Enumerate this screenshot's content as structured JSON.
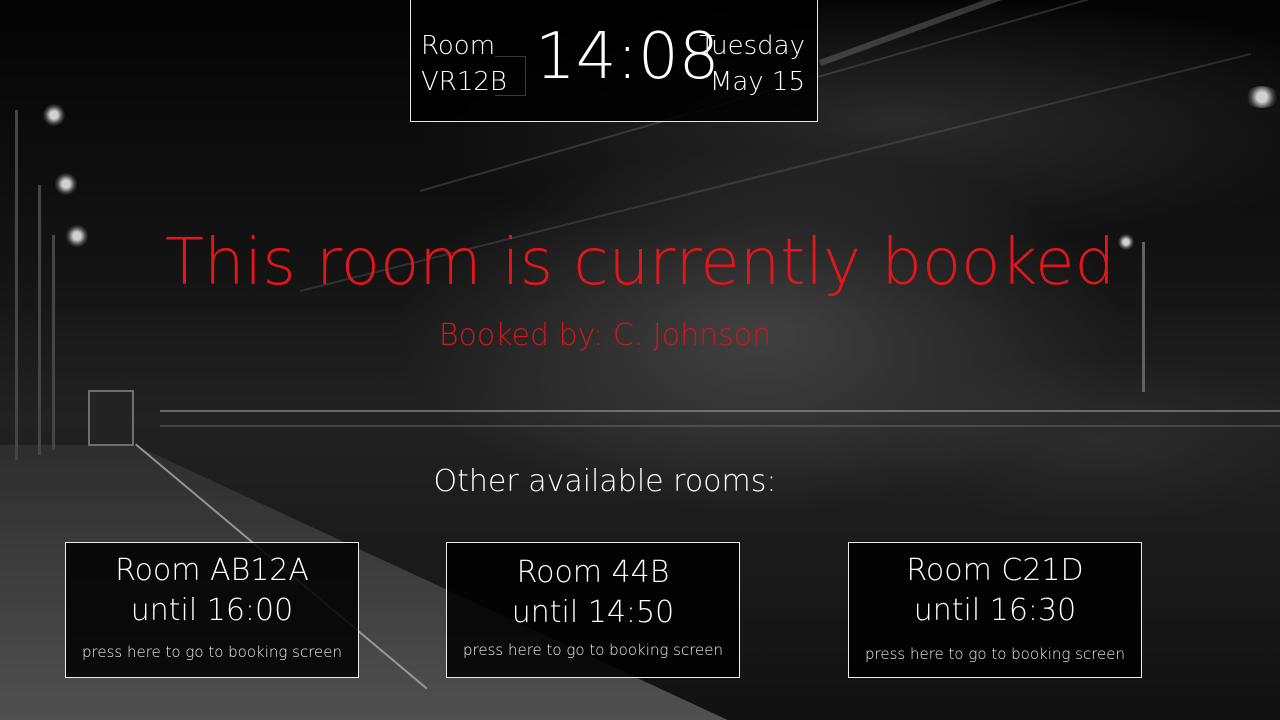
{
  "header": {
    "room_label_line1": "Room",
    "room_label_line2": "VR12B",
    "time": "14:08",
    "weekday": "Tuesday",
    "date": "May 15"
  },
  "status": {
    "title": "This room is currently booked",
    "booked_by": "Booked by: C. Johnson",
    "color": "#e3161b"
  },
  "other_rooms": {
    "heading": "Other available rooms:",
    "rooms": [
      {
        "name": "Room AB12A",
        "until": "until 16:00",
        "hint": "press here to go to booking screen"
      },
      {
        "name": "Room 44B",
        "until": "until 14:50",
        "hint": "press here to go to booking screen"
      },
      {
        "name": "Room C21D",
        "until": "until 16:30",
        "hint": "press here to go to booking screen"
      }
    ]
  }
}
